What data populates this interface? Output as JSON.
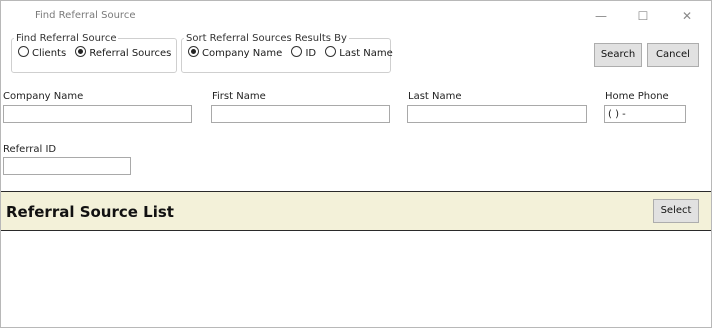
{
  "window": {
    "title": "Find Referral Source",
    "min": "—",
    "max": "☐",
    "close": "✕"
  },
  "find_group": {
    "legend": "Find Referral Source",
    "options": [
      {
        "label": "Clients",
        "selected": false
      },
      {
        "label": "Referral Sources",
        "selected": true
      }
    ]
  },
  "sort_group": {
    "legend": "Sort Referral Sources Results By",
    "options": [
      {
        "label": "Company Name",
        "selected": true
      },
      {
        "label": "ID",
        "selected": false
      },
      {
        "label": "Last Name",
        "selected": false
      }
    ]
  },
  "buttons": {
    "search": "Search",
    "cancel": "Cancel",
    "select": "Select"
  },
  "fields": {
    "company_name": {
      "label": "Company Name",
      "value": ""
    },
    "first_name": {
      "label": "First Name",
      "value": ""
    },
    "last_name": {
      "label": "Last Name",
      "value": ""
    },
    "home_phone": {
      "label": "Home Phone",
      "value": "(  )  -"
    },
    "referral_id": {
      "label": "Referral ID",
      "value": ""
    }
  },
  "list": {
    "title": "Referral Source List",
    "background": "#f3f1d9"
  }
}
